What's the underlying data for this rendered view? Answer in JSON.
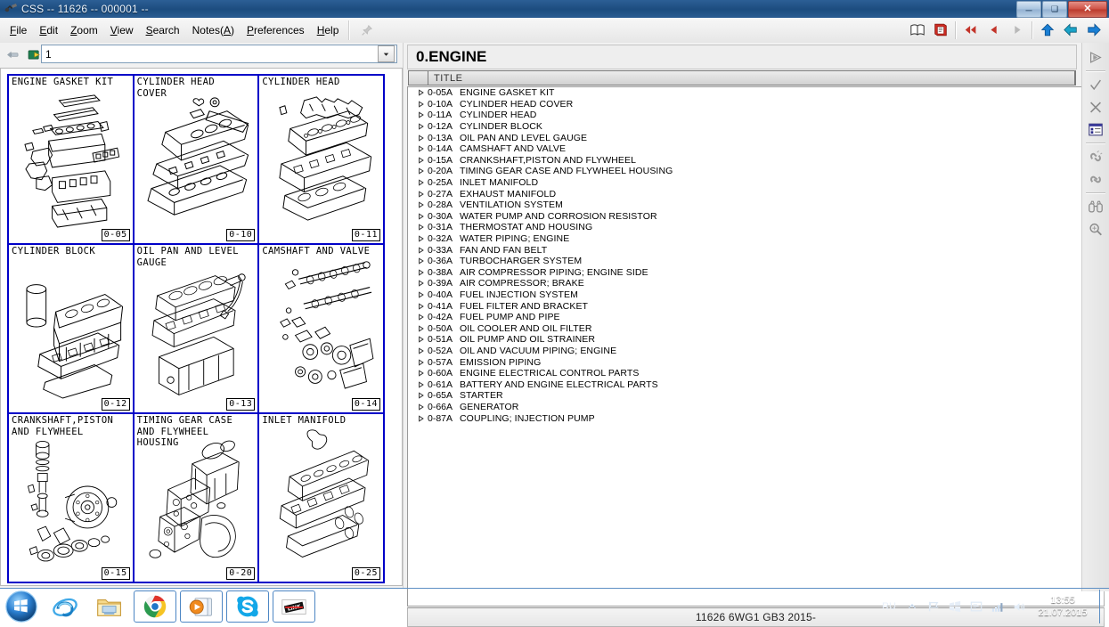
{
  "window": {
    "title": "CSS -- 11626 -- 000001 --",
    "app_icon": "app-icon",
    "minimize_label": "—",
    "maximize_label": "❐",
    "close_label": "✕"
  },
  "menubar": {
    "items": [
      {
        "label": "File",
        "accel": "F"
      },
      {
        "label": "Edit",
        "accel": "E"
      },
      {
        "label": "Zoom",
        "accel": "Z"
      },
      {
        "label": "View",
        "accel": "V"
      },
      {
        "label": "Search",
        "accel": "S"
      },
      {
        "label": "Notes(A)",
        "accel": "A"
      },
      {
        "label": "Preferences",
        "accel": "P"
      },
      {
        "label": "Help",
        "accel": "H"
      }
    ],
    "pin_icon": "pin-icon"
  },
  "toolbar": {
    "buttons": [
      {
        "name": "book-open-icon"
      },
      {
        "name": "book-red-icon"
      },
      {
        "name": "rewind-icon"
      },
      {
        "name": "previous-icon"
      },
      {
        "name": "next-icon"
      },
      {
        "name": "up-arrow-icon"
      },
      {
        "name": "back-arrow-icon"
      },
      {
        "name": "forward-arrow-icon"
      }
    ]
  },
  "left_pane": {
    "nav_back_icon": "nav-back-icon",
    "nav_forward_icon": "nav-forward-icon",
    "page_combo": {
      "value": "1",
      "placeholder": "1",
      "dropdown_icon": "chevron-down-icon"
    },
    "thumbnails": [
      {
        "label": "ENGINE GASKET KIT",
        "code": "0-05",
        "art": "gasket"
      },
      {
        "label": "CYLINDER HEAD\nCOVER",
        "code": "0-10",
        "art": "headcover"
      },
      {
        "label": "CYLINDER HEAD",
        "code": "0-11",
        "art": "head"
      },
      {
        "label": "CYLINDER BLOCK",
        "code": "0-12",
        "art": "block"
      },
      {
        "label": "OIL PAN AND LEVEL\nGAUGE",
        "code": "0-13",
        "art": "oilpan"
      },
      {
        "label": "CAMSHAFT AND VALVE",
        "code": "0-14",
        "art": "camshaft"
      },
      {
        "label": "CRANKSHAFT,PISTON\nAND FLYWHEEL",
        "code": "0-15",
        "art": "crank"
      },
      {
        "label": "TIMING GEAR CASE\nAND FLYWHEEL\nHOUSING",
        "code": "0-20",
        "art": "timing"
      },
      {
        "label": "INLET MANIFOLD",
        "code": "0-25",
        "art": "inlet"
      }
    ]
  },
  "right_pane": {
    "header_title": "0.ENGINE",
    "columns": [
      "",
      "TITLE"
    ],
    "rows": [
      {
        "expander": "expand-triangle-icon",
        "code": "0-05A",
        "title": "ENGINE GASKET KIT"
      },
      {
        "expander": "expand-triangle-icon",
        "code": "0-10A",
        "title": "CYLINDER HEAD COVER"
      },
      {
        "expander": "expand-triangle-icon",
        "code": "0-11A",
        "title": "CYLINDER HEAD"
      },
      {
        "expander": "expand-triangle-icon",
        "code": "0-12A",
        "title": "CYLINDER BLOCK"
      },
      {
        "expander": "expand-triangle-icon",
        "code": "0-13A",
        "title": "OIL PAN AND LEVEL GAUGE"
      },
      {
        "expander": "expand-triangle-icon",
        "code": "0-14A",
        "title": "CAMSHAFT AND VALVE"
      },
      {
        "expander": "expand-triangle-icon",
        "code": "0-15A",
        "title": "CRANKSHAFT,PISTON AND FLYWHEEL"
      },
      {
        "expander": "expand-triangle-icon",
        "code": "0-20A",
        "title": "TIMING GEAR CASE AND FLYWHEEL HOUSING"
      },
      {
        "expander": "expand-triangle-icon",
        "code": "0-25A",
        "title": "INLET MANIFOLD"
      },
      {
        "expander": "expand-triangle-icon",
        "code": "0-27A",
        "title": "EXHAUST MANIFOLD"
      },
      {
        "expander": "expand-triangle-icon",
        "code": "0-28A",
        "title": "VENTILATION SYSTEM"
      },
      {
        "expander": "expand-triangle-icon",
        "code": "0-30A",
        "title": "WATER PUMP AND CORROSION RESISTOR"
      },
      {
        "expander": "expand-triangle-icon",
        "code": "0-31A",
        "title": "THERMOSTAT AND HOUSING"
      },
      {
        "expander": "expand-triangle-icon",
        "code": "0-32A",
        "title": "WATER PIPING; ENGINE"
      },
      {
        "expander": "expand-triangle-icon",
        "code": "0-33A",
        "title": "FAN AND FAN BELT"
      },
      {
        "expander": "expand-triangle-icon",
        "code": "0-36A",
        "title": "TURBOCHARGER SYSTEM"
      },
      {
        "expander": "expand-triangle-icon",
        "code": "0-38A",
        "title": "AIR COMPRESSOR PIPING; ENGINE SIDE"
      },
      {
        "expander": "expand-triangle-icon",
        "code": "0-39A",
        "title": "AIR COMPRESSOR; BRAKE"
      },
      {
        "expander": "expand-triangle-icon",
        "code": "0-40A",
        "title": "FUEL INJECTION SYSTEM"
      },
      {
        "expander": "expand-triangle-icon",
        "code": "0-41A",
        "title": "FUEL FILTER AND BRACKET"
      },
      {
        "expander": "expand-triangle-icon",
        "code": "0-42A",
        "title": "FUEL PUMP AND PIPE"
      },
      {
        "expander": "expand-triangle-icon",
        "code": "0-50A",
        "title": "OIL COOLER AND OIL FILTER"
      },
      {
        "expander": "expand-triangle-icon",
        "code": "0-51A",
        "title": "OIL PUMP AND OIL STRAINER"
      },
      {
        "expander": "expand-triangle-icon",
        "code": "0-52A",
        "title": "OIL AND VACUUM PIPING; ENGINE"
      },
      {
        "expander": "expand-triangle-icon",
        "code": "0-57A",
        "title": "EMISSION PIPING"
      },
      {
        "expander": "expand-triangle-icon",
        "code": "0-60A",
        "title": "ENGINE ELECTRICAL CONTROL PARTS"
      },
      {
        "expander": "expand-triangle-icon",
        "code": "0-61A",
        "title": "BATTERY AND ENGINE ELECTRICAL PARTS"
      },
      {
        "expander": "expand-triangle-icon",
        "code": "0-65A",
        "title": "STARTER"
      },
      {
        "expander": "expand-triangle-icon",
        "code": "0-66A",
        "title": "GENERATOR"
      },
      {
        "expander": "expand-triangle-icon",
        "code": "0-87A",
        "title": "COUPLING; INJECTION PUMP"
      }
    ],
    "status": "11626 6WG1 GB3 2015-"
  },
  "vertical_toolbar": {
    "buttons": [
      {
        "name": "play-arrow-icon"
      },
      {
        "name": "check-icon"
      },
      {
        "name": "close-x-icon"
      },
      {
        "name": "list-window-icon"
      },
      {
        "name": "link-break-icon"
      },
      {
        "name": "link-icon"
      },
      {
        "name": "binoculars-icon"
      },
      {
        "name": "zoom-search-icon"
      }
    ]
  },
  "taskbar": {
    "start_label": "start-orb",
    "apps": [
      {
        "name": "internet-explorer-icon",
        "boxed": false
      },
      {
        "name": "file-explorer-icon",
        "boxed": false
      },
      {
        "name": "google-chrome-icon",
        "boxed": true
      },
      {
        "name": "media-player-icon",
        "boxed": true
      },
      {
        "name": "skype-icon",
        "boxed": true
      },
      {
        "name": "css-app-icon",
        "boxed": true
      }
    ],
    "tray": {
      "language": "RU",
      "icons": [
        "show-hidden-icons-chevron",
        "flag-action-center-icon",
        "network-windows-icon",
        "explorer-tray-icon",
        "signal-bars-icon",
        "volume-speaker-icon"
      ],
      "time": "13:55",
      "date": "21.07.2015"
    }
  },
  "colors": {
    "titlebar": "#1f4f82",
    "thumb_border": "#0000c8",
    "taskbar": "#0f2a50",
    "accent_blue": "#1a6fd4"
  }
}
